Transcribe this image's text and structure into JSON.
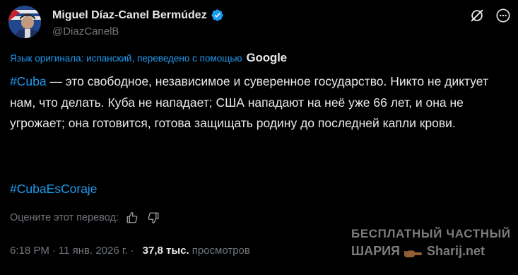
{
  "author": {
    "display_name": "Miguel Díaz-Canel Bermúdez",
    "handle": "@DiazCanelB",
    "verified": true,
    "avatar_icon": "avatar-photo"
  },
  "header_actions": {
    "grok_icon": "grok-icon",
    "more_icon": "more-icon"
  },
  "translation": {
    "label": "Язык оригинала: испанский, переведено с помощью",
    "provider": "Google"
  },
  "tweet": {
    "hashtag1": "#Cuba",
    "text": " — это свободное, независимое и суверенное государство. Никто не диктует нам, что делать. Куба не нападает; США нападают на неё уже 66 лет, и она не угрожает; она готовится, готова защищать родину до последней капли крови.",
    "hashtag2": "#CubaEsCoraje"
  },
  "rate_translation": {
    "label": "Оцените этот перевод:"
  },
  "meta": {
    "time": "6:18 PM",
    "separator1": "·",
    "date": "11 янв. 2026 г.",
    "separator2": "·",
    "views_count": "37,8 тыс.",
    "views_label": "просмотров"
  },
  "watermark": {
    "line1": "БЕСПЛАТНЫЙ ЧАСТНЫЙ",
    "line2_left": "ШАРИЯ",
    "line2_right": "Sharij.net"
  },
  "colors": {
    "background": "#000000",
    "text_primary": "#e7e9ea",
    "text_secondary": "#71767b",
    "link_blue": "#1d9bf0",
    "verified_blue": "#1d9bf0"
  }
}
